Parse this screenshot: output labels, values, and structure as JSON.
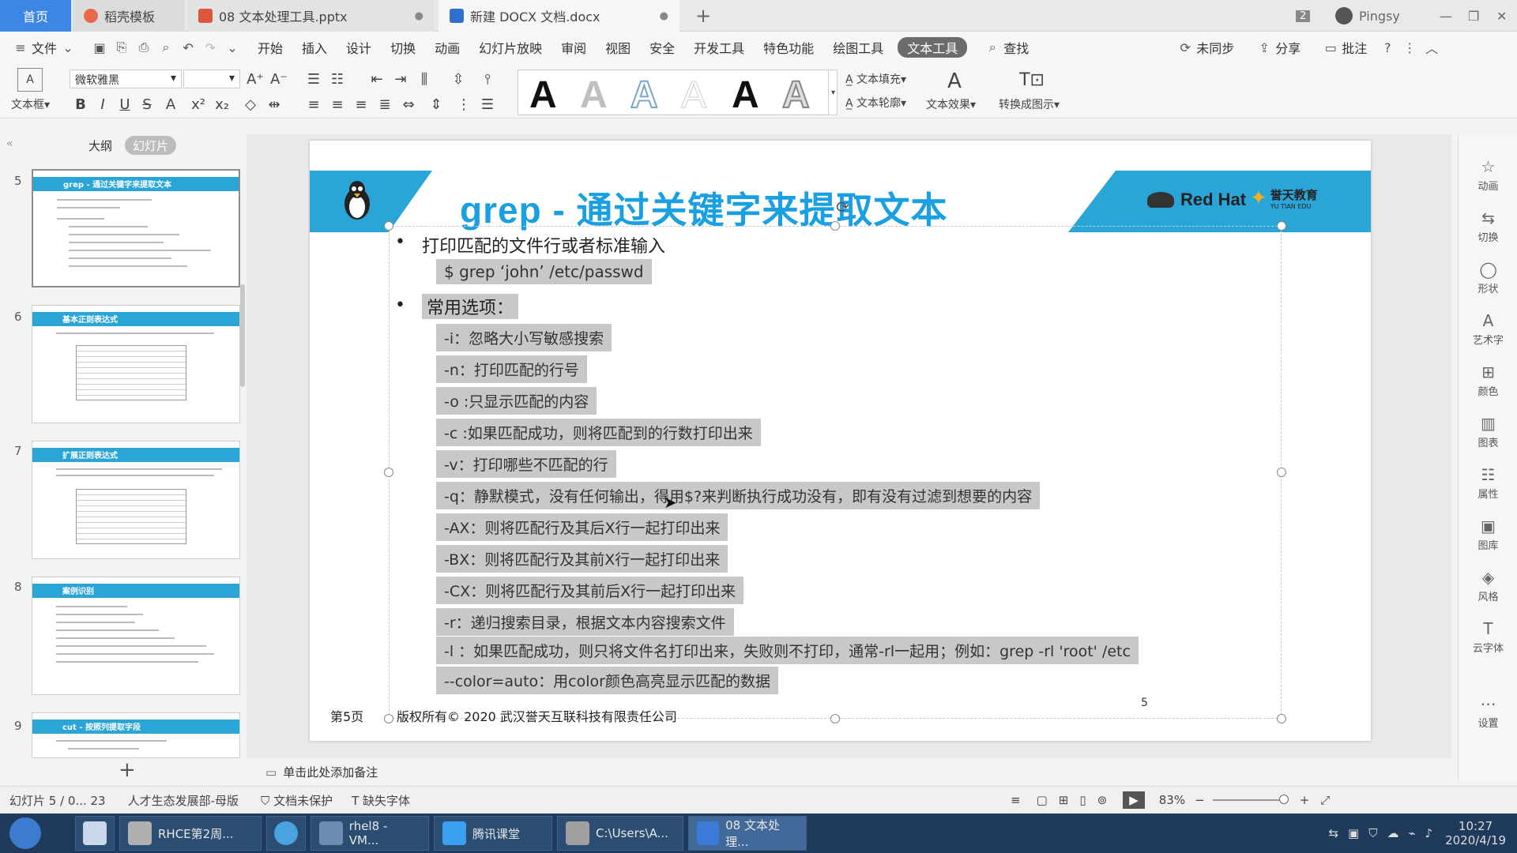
{
  "tabs": {
    "home": "首页",
    "template": "稻壳模板",
    "pptx": "08 文本处理工具.pptx",
    "docx": "新建 DOCX 文档.docx",
    "badge": "2",
    "user": "Pingsy"
  },
  "menu": {
    "file": "文件",
    "items": [
      "开始",
      "插入",
      "设计",
      "切换",
      "动画",
      "幻灯片放映",
      "审阅",
      "视图",
      "安全",
      "开发工具",
      "特色功能",
      "绘图工具"
    ],
    "active": "文本工具",
    "search": "查找",
    "sync": "未同步",
    "share": "分享",
    "annotate": "批注"
  },
  "ribbon": {
    "textbox": "文本框",
    "font_name": "微软雅黑",
    "font_size": "",
    "text_fill": "文本填充",
    "text_outline": "文本轮廓",
    "text_effect": "文本效果",
    "convert": "转换成图示",
    "style_letter": "A"
  },
  "leftpanel": {
    "outline_tab": "大纲",
    "slides_tab": "幻灯片",
    "thumbs": [
      {
        "num": "5",
        "title": "grep - 通过关键字来提取文本"
      },
      {
        "num": "6",
        "title": "基本正则表达式"
      },
      {
        "num": "7",
        "title": "扩展正则表达式"
      },
      {
        "num": "8",
        "title": "案例识别"
      },
      {
        "num": "9",
        "title": "cut - 按照列提取字段"
      }
    ]
  },
  "slide": {
    "title": "grep - 通过关键字来提取文本",
    "brand1": "Red Hat",
    "brand2": "誉天教育",
    "brand2_sub": "YU TIAN EDU",
    "bullet1": "打印匹配的文件行或者标准输入",
    "cmd": "$ grep ‘john’ /etc/passwd",
    "bullet2": "常用选项：",
    "options": [
      "-i：忽略大小写敏感搜索",
      "-n：打印匹配的行号",
      "-o :只显示匹配的内容",
      "-c :如果匹配成功，则将匹配到的行数打印出来",
      "-v：打印哪些不匹配的行",
      "-q：静默模式，没有任何输出，得用$?来判断执行成功没有，即有没有过滤到想要的内容",
      "-AX：则将匹配行及其后X行一起打印出来",
      "-BX：则将匹配行及其前X行一起打印出来",
      "-CX：则将匹配行及其前后X行一起打印出来",
      "-r：递归搜索目录，根据文本内容搜索文件",
      "-l ：如果匹配成功，则只将文件名打印出来，失败则不打印，通常-rl一起用；例如：grep -rl 'root' /etc",
      "--color=auto：用color颜色高亮显示匹配的数据"
    ],
    "footer_page": "第5页",
    "footer_copy": "版权所有© 2020 武汉誉天互联科技有限责任公司",
    "footer_num": "5"
  },
  "rightbar": [
    "动画",
    "切换",
    "形状",
    "艺术字",
    "颜色",
    "图表",
    "属性",
    "图库",
    "风格",
    "云字体",
    "设置"
  ],
  "notes": "单击此处添加备注",
  "status": {
    "slide_info": "幻灯片 5 / 0... 23",
    "layout": "人才生态发展部-母版",
    "protect": "文档未保护",
    "font_missing": "缺失字体",
    "zoom": "83%"
  },
  "taskbar": {
    "apps": [
      "RHCE第2周...",
      "",
      "rhel8 - VM...",
      "腾讯课堂",
      "C:\\Users\\A...",
      "08 文本处理..."
    ],
    "time": "10:27",
    "date": "2020/4/19"
  },
  "colors": {
    "accent_blue": "#2aa5d8",
    "title_blue": "#1aa0e0",
    "tab_home": "#3d86e6",
    "taskbar": "#1f3a5a"
  }
}
